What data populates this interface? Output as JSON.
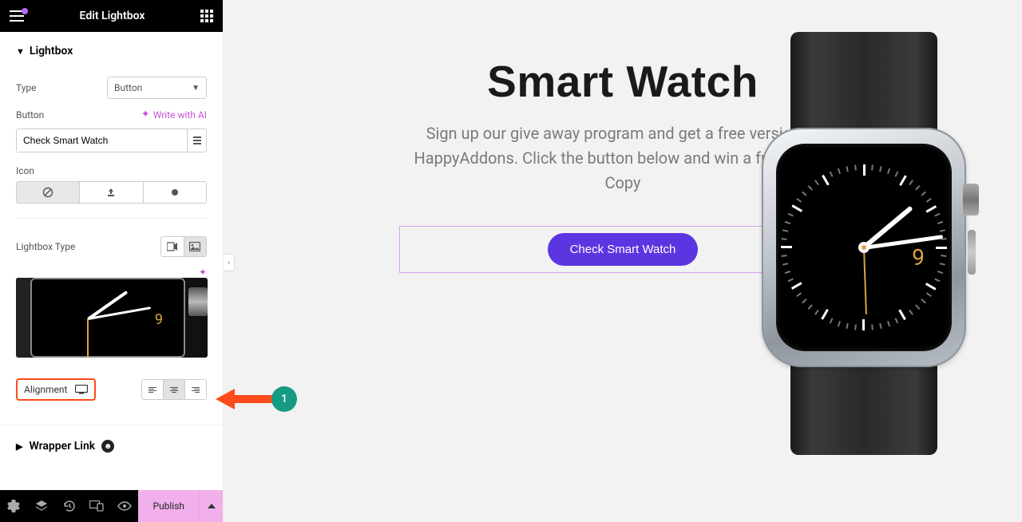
{
  "header": {
    "title": "Edit Lightbox"
  },
  "section": {
    "name": "Lightbox",
    "type_label": "Type",
    "type_value": "Button",
    "button_label": "Button",
    "write_ai": "Write with AI",
    "button_input": "Check Smart Watch",
    "icon_label": "Icon",
    "lightbox_type_label": "Lightbox Type",
    "alignment_label": "Alignment"
  },
  "wrapper": {
    "label": "Wrapper Link"
  },
  "footer": {
    "publish": "Publish"
  },
  "preview": {
    "heading": "Smart Watch",
    "subtext": "Sign up our give away program and get a free version of HappyAddons. Click the button below and win a free Plugin Copy",
    "button": "Check Smart Watch",
    "watch_number": "9"
  },
  "annotation": {
    "step": "1"
  }
}
